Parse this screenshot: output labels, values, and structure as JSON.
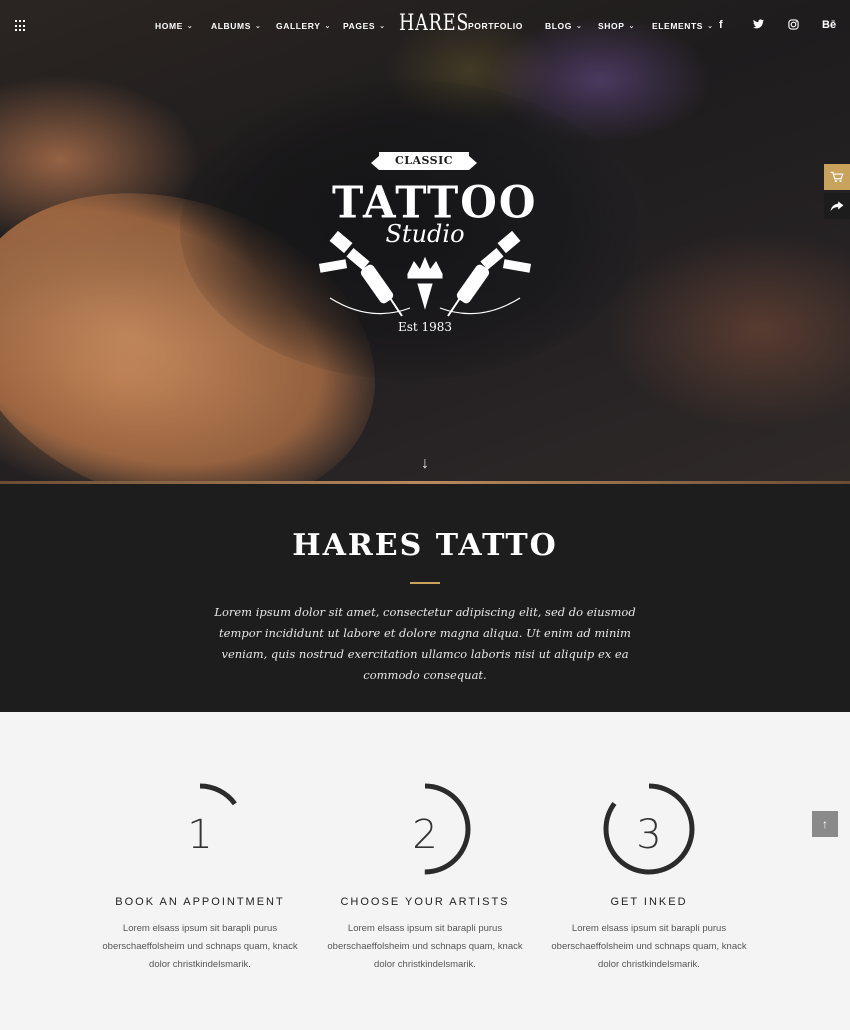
{
  "nav": {
    "brand": "HARES",
    "items": [
      {
        "label": "HOME"
      },
      {
        "label": "ALBUMS"
      },
      {
        "label": "GALLERY"
      },
      {
        "label": "PAGES"
      },
      {
        "label": "PORTFOLIO"
      },
      {
        "label": "BLOG"
      },
      {
        "label": "SHOP"
      },
      {
        "label": "ELEMENTS"
      }
    ],
    "social": [
      "f",
      "t",
      "ig",
      "Bē"
    ]
  },
  "hero": {
    "badge": "CLASSIC",
    "logo_title": "TATTOO",
    "logo_subtitle": "Studio",
    "established": "Est 1983"
  },
  "intro": {
    "title": "HARES TATTO",
    "text": "Lorem ipsum dolor sit amet, consectetur adipiscing elit, sed do eiusmod tempor incididunt ut labore et dolore magna aliqua. Ut enim ad minim veniam, quis nostrud exercitation ullamco laboris nisi ut aliquip ex ea commodo consequat."
  },
  "steps": [
    {
      "number": "1",
      "title": "BOOK AN APPOINTMENT",
      "text": "Lorem elsass ipsum sit barapli purus oberschaeffolsheim und schnaps quam, knack dolor christkindelsmarik.",
      "progress": 0.15
    },
    {
      "number": "2",
      "title": "CHOOSE YOUR ARTISTS",
      "text": "Lorem elsass ipsum sit barapli purus oberschaeffolsheim und schnaps quam, knack dolor christkindelsmarik.",
      "progress": 0.5
    },
    {
      "number": "3",
      "title": "GET INKED",
      "text": "Lorem elsass ipsum sit barapli purus oberschaeffolsheim und schnaps quam, knack dolor christkindelsmarik.",
      "progress": 0.85
    }
  ],
  "colors": {
    "accent": "#c9a25c",
    "dark": "#1d1d1e"
  }
}
